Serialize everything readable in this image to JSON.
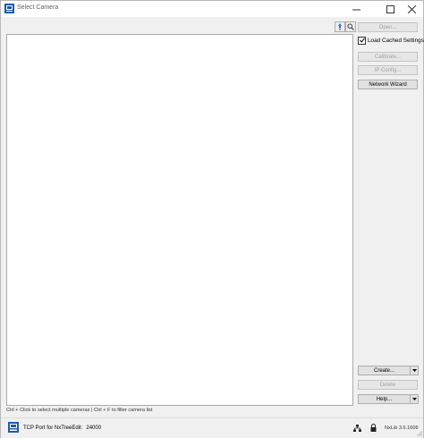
{
  "window": {
    "title": "Select Camera"
  },
  "toolbar": {
    "pin_icon": "pin-icon",
    "search_icon": "search-icon"
  },
  "sidebar": {
    "open_label": "Open...",
    "load_cached_label": "Load Cached Settings",
    "load_cached_checked": true,
    "calibrate_label": "Calibrate...",
    "ip_config_label": "IP Config...",
    "network_wizard_label": "Network Wizard",
    "create_label": "Create...",
    "delete_label": "Delete",
    "help_label": "Help..."
  },
  "hint": {
    "text": "Ctrl + Click to select multiple cameras | Ctrl + F to filter camera list"
  },
  "status": {
    "port_label": "TCP Port for NxTreeEdit:",
    "port_value": "24000",
    "version": "NxLib 3.6.1606"
  },
  "colors": {
    "accent": "#1e5aa8",
    "disabled_text": "#a0a0a0"
  }
}
